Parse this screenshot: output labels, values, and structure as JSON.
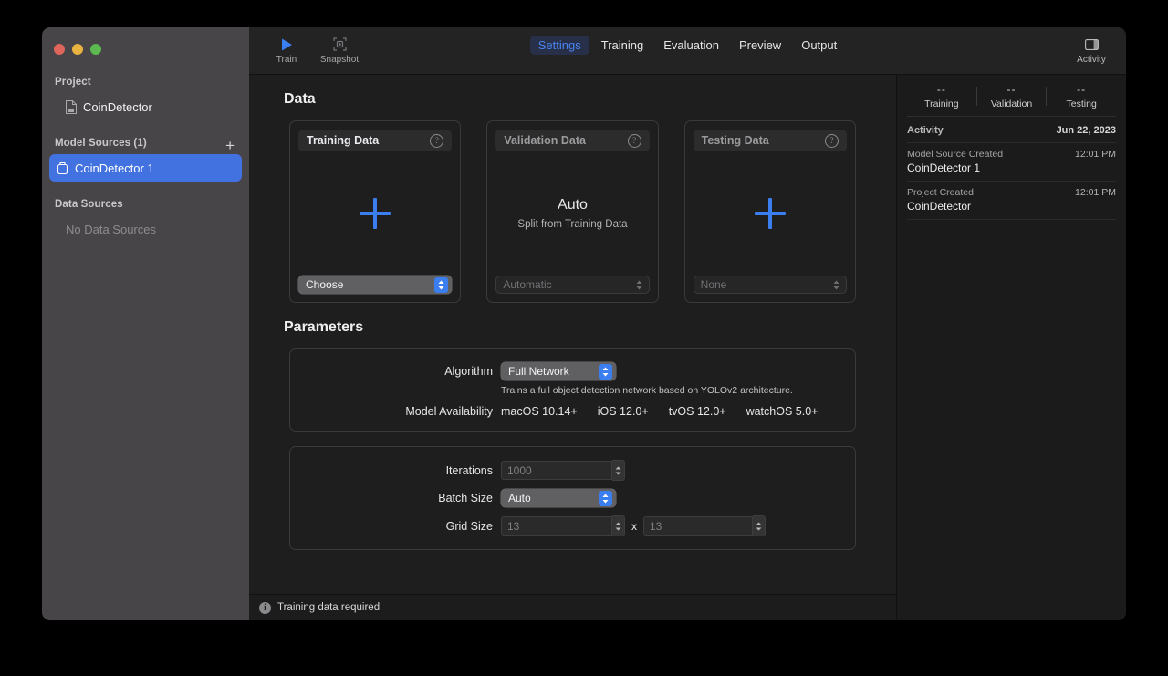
{
  "window": {
    "traffic_lights": [
      "close",
      "minimize",
      "zoom"
    ]
  },
  "sidebar": {
    "project_label": "Project",
    "project_name": "CoinDetector",
    "model_sources_label": "Model Sources (1)",
    "add_button": "+",
    "model_sources": [
      {
        "name": "CoinDetector 1",
        "selected": true
      }
    ],
    "data_sources_label": "Data Sources",
    "data_sources_empty": "No Data Sources"
  },
  "toolbar": {
    "train_label": "Train",
    "snapshot_label": "Snapshot",
    "activity_label": "Activity",
    "tabs": [
      {
        "label": "Settings",
        "active": true
      },
      {
        "label": "Training",
        "active": false
      },
      {
        "label": "Evaluation",
        "active": false
      },
      {
        "label": "Preview",
        "active": false
      },
      {
        "label": "Output",
        "active": false
      }
    ]
  },
  "main": {
    "data_section_title": "Data",
    "cards": [
      {
        "title": "Training Data",
        "help": "?",
        "body_kind": "plus",
        "popup_value": "Choose",
        "popup_enabled": true
      },
      {
        "title": "Validation Data",
        "help": "?",
        "body_kind": "auto",
        "auto_title": "Auto",
        "auto_subtitle": "Split from Training Data",
        "popup_value": "Automatic",
        "popup_enabled": false
      },
      {
        "title": "Testing Data",
        "help": "?",
        "body_kind": "plus",
        "popup_value": "None",
        "popup_enabled": false
      }
    ],
    "parameters_section_title": "Parameters",
    "algorithm": {
      "label": "Algorithm",
      "value": "Full Network",
      "note": "Trains a full object detection network based on YOLOv2 architecture.",
      "availability_label": "Model Availability",
      "availability": [
        "macOS 10.14+",
        "iOS 12.0+",
        "tvOS 12.0+",
        "watchOS 5.0+"
      ]
    },
    "training_params": {
      "iterations_label": "Iterations",
      "iterations_value": "1000",
      "batch_size_label": "Batch Size",
      "batch_size_value": "Auto",
      "grid_size_label": "Grid Size",
      "grid_size_width": "13",
      "grid_size_separator": "x",
      "grid_size_height": "13"
    }
  },
  "statusbar": {
    "icon": "info-icon",
    "message": "Training data required"
  },
  "activity_panel": {
    "metrics": [
      {
        "value": "--",
        "label": "Training"
      },
      {
        "value": "--",
        "label": "Validation"
      },
      {
        "value": "--",
        "label": "Testing"
      }
    ],
    "activity_title": "Activity",
    "activity_date": "Jun 22, 2023",
    "events": [
      {
        "kind": "Model Source Created",
        "time": "12:01 PM",
        "name": "CoinDetector 1"
      },
      {
        "kind": "Project Created",
        "time": "12:01 PM",
        "name": "CoinDetector"
      }
    ]
  }
}
